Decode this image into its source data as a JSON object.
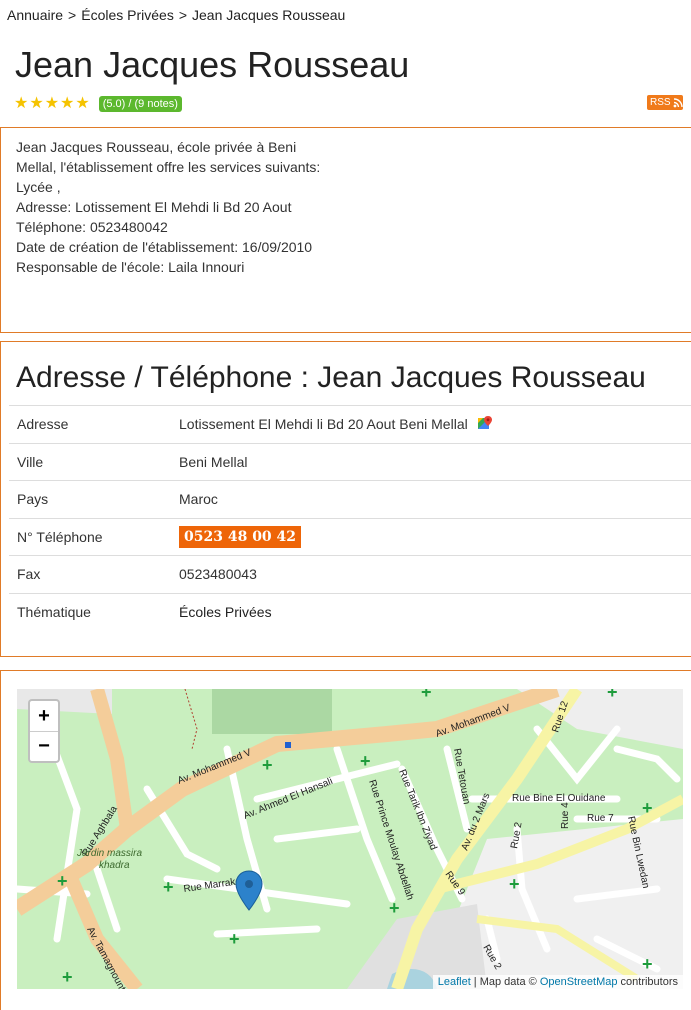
{
  "breadcrumb": {
    "home": "Annuaire",
    "category": "Écoles Privées",
    "current": "Jean Jacques Rousseau",
    "separator": ">"
  },
  "title": "Jean Jacques Rousseau",
  "rating": {
    "stars": 5,
    "label": "(5.0) / (9 notes)"
  },
  "rss_label": "RSS",
  "description": [
    "Jean Jacques Rousseau, école privée à Beni",
    "Mellal, l'établissement offre les services suivants:",
    "Lycée ,",
    "Adresse: Lotissement El Mehdi li Bd 20 Aout",
    "Téléphone: 0523480042",
    "Date de création de l'établissement: 16/09/2010",
    "Responsable de l'école: Laila Innouri"
  ],
  "contact": {
    "heading": "Adresse / Téléphone : Jean Jacques Rousseau",
    "rows": [
      {
        "key": "Adresse",
        "value": "Lotissement El Mehdi li Bd 20 Aout Beni Mellal"
      },
      {
        "key": "Ville",
        "value": "Beni Mellal"
      },
      {
        "key": "Pays",
        "value": "Maroc"
      },
      {
        "key": "N° Téléphone",
        "value": "0523 48 00 42"
      },
      {
        "key": "Fax",
        "value": "0523480043"
      },
      {
        "key": "Thématique",
        "value": "Écoles Privées"
      }
    ]
  },
  "map": {
    "zoom_in": "+",
    "zoom_out": "−",
    "attribution": {
      "leaflet": "Leaflet",
      "sep": " | Map data © ",
      "osm": "OpenStreetMap",
      "suffix": " contributors"
    },
    "labels": {
      "mohammed_v": "Av. Mohammed V",
      "mohammed_v_2": "Av. Mohammed V",
      "ahmed_hansali": "Av. Ahmed El Hansali",
      "aghbala": "Rue Aghbala",
      "jardin": "Jardin massira",
      "jardin2": "khadra",
      "marrakech": "Rue Marrakech",
      "tamagnounte": "Av. Tamagnounte",
      "prince": "Rue Prince Moulay Abdellah",
      "tarik": "Rue Tarik Ibn Ziyad",
      "tetouan": "Rue Tetouan",
      "deux_mars": "Av. du 2 Mars",
      "bine": "Rue Bine El Ouidane",
      "rue12": "Rue 12",
      "rue4": "Rue 4",
      "rue7": "Rue 7",
      "rue2a": "Rue 2",
      "rue2b": "Rue 2",
      "rue9": "Rue 9",
      "lwedan": "Rue Bin Lwedan"
    }
  }
}
